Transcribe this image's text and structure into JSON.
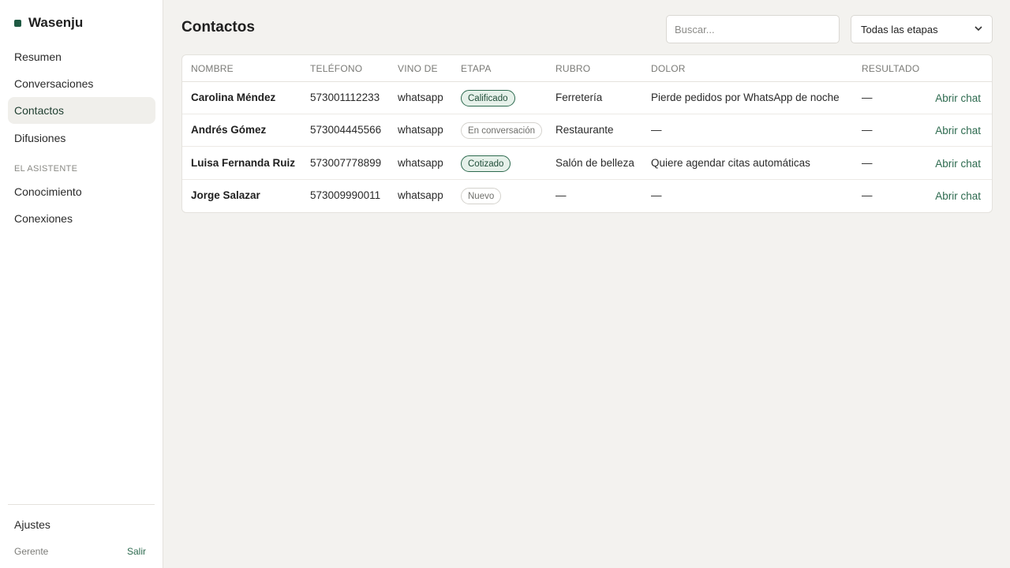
{
  "app": {
    "name": "Wasenju"
  },
  "sidebar": {
    "items": [
      {
        "label": "Resumen"
      },
      {
        "label": "Conversaciones"
      },
      {
        "label": "Contactos"
      },
      {
        "label": "Difusiones"
      }
    ],
    "section_label": "EL ASISTENTE",
    "assistant_items": [
      {
        "label": "Conocimiento"
      },
      {
        "label": "Conexiones"
      }
    ],
    "settings_label": "Ajustes",
    "user_role": "Gerente",
    "logout_label": "Salir"
  },
  "main": {
    "title": "Contactos",
    "search": {
      "placeholder": "Buscar..."
    },
    "stage_filter": {
      "selected": "Todas las etapas"
    },
    "table": {
      "headers": [
        "NOMBRE",
        "TELÉFONO",
        "VINO DE",
        "ETAPA",
        "RUBRO",
        "DOLOR",
        "RESULTADO"
      ],
      "action_label": "Abrir chat",
      "rows": [
        {
          "name": "Carolina Méndez",
          "phone": "573001112233",
          "source": "whatsapp",
          "stage": "Calificado",
          "industry": "Ferretería",
          "pain": "Pierde pedidos por WhatsApp de noche",
          "result": "—"
        },
        {
          "name": "Andrés Gómez",
          "phone": "573004445566",
          "source": "whatsapp",
          "stage": "En conversación",
          "industry": "Restaurante",
          "pain": "—",
          "result": "—"
        },
        {
          "name": "Luisa Fernanda Ruiz",
          "phone": "573007778899",
          "source": "whatsapp",
          "stage": "Cotizado",
          "industry": "Salón de belleza",
          "pain": "Quiere agendar citas automáticas",
          "result": "—"
        },
        {
          "name": "Jorge Salazar",
          "phone": "573009990011",
          "source": "whatsapp",
          "stage": "Nuevo",
          "industry": "—",
          "pain": "—",
          "result": "—"
        }
      ]
    }
  },
  "colors": {
    "accent": "#2d6a4f",
    "brand": "#1f5a43",
    "background": "#f3f2ef"
  },
  "icons": {
    "select_chevron": "chevron-down-icon",
    "brand_mark": "brand-dot-icon"
  }
}
